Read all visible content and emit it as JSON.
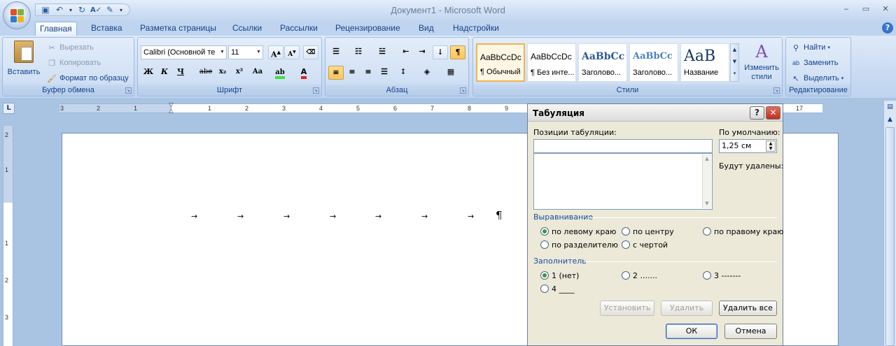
{
  "window": {
    "title": "Документ1 - Microsoft Word",
    "controls": [
      "‒",
      "▭",
      "✕"
    ]
  },
  "qat": {
    "icons": [
      "save-icon",
      "undo-icon",
      "redo-icon",
      "spelling-icon",
      "format-icon",
      "customize-icon"
    ]
  },
  "tabs": [
    "Главная",
    "Вставка",
    "Разметка страницы",
    "Ссылки",
    "Рассылки",
    "Рецензирование",
    "Вид",
    "Надстройки"
  ],
  "ribbon": {
    "clipboard": {
      "label": "Буфер обмена",
      "paste": "Вставить",
      "cut": "Вырезать",
      "copy": "Копировать",
      "format_painter": "Формат по образцу"
    },
    "font": {
      "label": "Шрифт",
      "font_name": "Calibri (Основной те",
      "font_size": "11",
      "bold": "Ж",
      "italic": "К",
      "underline": "Ч",
      "strike": "abe",
      "sub": "x₂",
      "sup": "x²",
      "case": "Aa",
      "grow": "A",
      "shrink": "A"
    },
    "paragraph": {
      "label": "Абзац"
    },
    "styles": {
      "label": "Стили",
      "items": [
        {
          "preview": "AaBbCcDc",
          "name": "¶ Обычный"
        },
        {
          "preview": "AaBbCcDc",
          "name": "¶ Без инте..."
        },
        {
          "preview": "AaBbCc",
          "name": "Заголово..."
        },
        {
          "preview": "AaBbCc",
          "name": "Заголово..."
        },
        {
          "preview": "AaB",
          "name": "Название"
        }
      ],
      "change_styles": "Изменить стили"
    },
    "editing": {
      "label": "Редактирование",
      "find": "Найти",
      "replace": "Заменить",
      "select": "Выделить"
    }
  },
  "ruler": {
    "h_numbers": [
      "3",
      "2",
      "1",
      "1",
      "2",
      "3",
      "4",
      "5",
      "6",
      "7",
      "8",
      "9",
      "17"
    ],
    "v_numbers": [
      "2",
      "1",
      "1",
      "2",
      "3"
    ]
  },
  "document": {
    "pilcrow": "¶",
    "tab_arrow": "→"
  },
  "dialog": {
    "title": "Табуляция",
    "tab_positions_label": "Позиции табуляции:",
    "tab_positions_value": "",
    "default_label": "По умолчанию:",
    "default_value": "1,25 см",
    "to_be_cleared": "Будут удалены:",
    "alignment_label": "Выравнивание",
    "alignment": {
      "left": "по левому краю",
      "center": "по центру",
      "right": "по правому краю",
      "decimal": "по разделителю",
      "bar": "с чертой"
    },
    "leader_label": "Заполнитель",
    "leader": {
      "l1": "1 (нет)",
      "l2": "2 .......",
      "l3": "3 -------",
      "l4": "4 ____"
    },
    "buttons": {
      "set": "Установить",
      "clear": "Удалить",
      "clear_all": "Удалить все",
      "ok": "ОК",
      "cancel": "Отмена"
    }
  },
  "colors": {
    "accent": "#15428b",
    "selected_style": "#f2b34b",
    "radio_checked": "#2e9b45",
    "close_button": "#c12d18"
  }
}
